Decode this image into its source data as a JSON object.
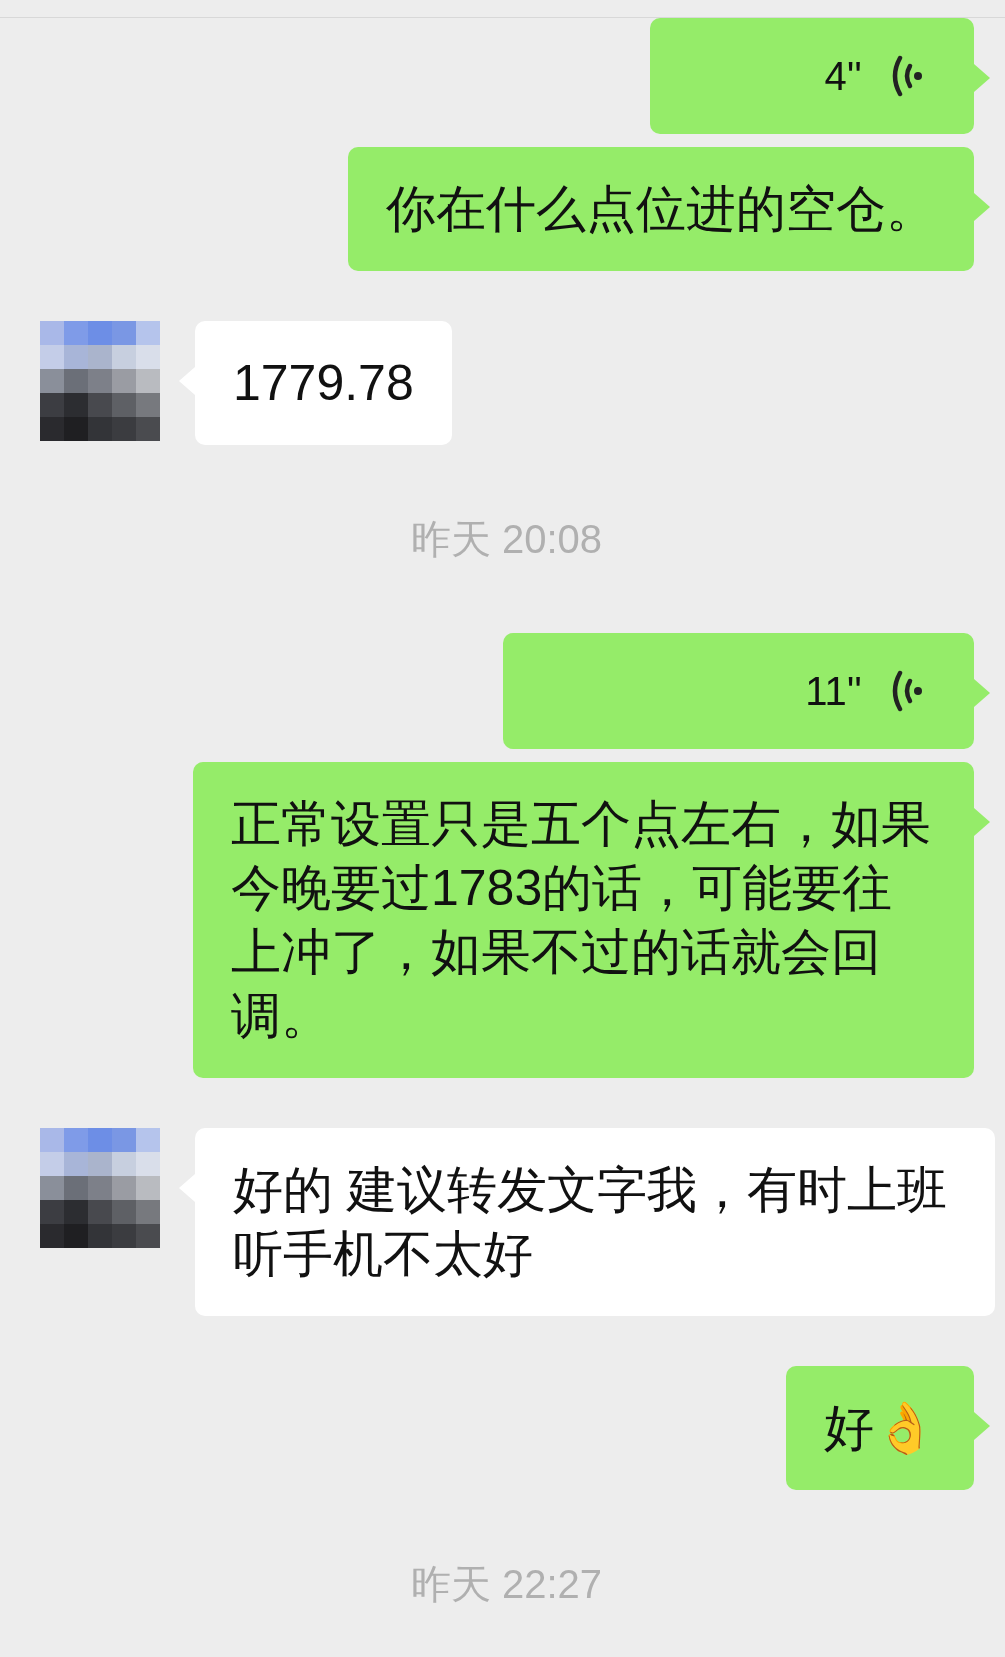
{
  "messages": [
    {
      "kind": "voice",
      "outgoing": true,
      "duration": "4''"
    },
    {
      "kind": "text",
      "outgoing": true,
      "text": "你在什么点位进的空仓。"
    },
    {
      "kind": "text",
      "outgoing": false,
      "text": "1779.78"
    },
    {
      "kind": "timestamp",
      "text": "昨天 20:08"
    },
    {
      "kind": "voice",
      "outgoing": true,
      "duration": "11''"
    },
    {
      "kind": "text",
      "outgoing": true,
      "text": "正常设置只是五个点左右，如果今晚要过1783的话，可能要往上冲了，如果不过的话就会回调。"
    },
    {
      "kind": "text",
      "outgoing": false,
      "text": "好的 建议转发文字我，有时上班听手机不太好"
    },
    {
      "kind": "text",
      "outgoing": true,
      "text": "好👌"
    },
    {
      "kind": "timestamp",
      "text": "昨天 22:27"
    }
  ]
}
